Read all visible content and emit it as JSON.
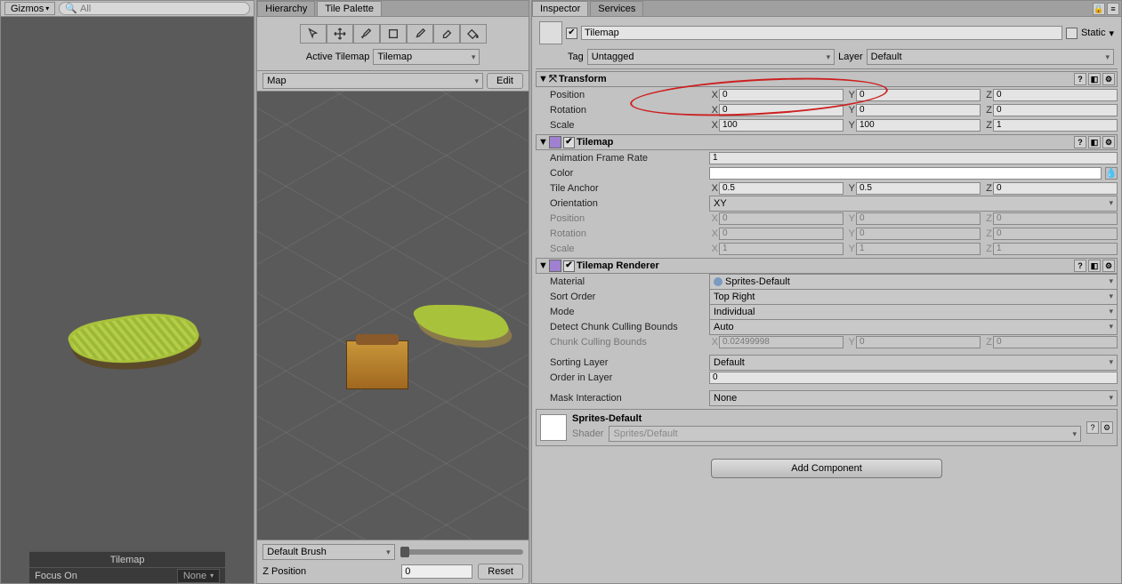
{
  "scene": {
    "gizmos_label": "Gizmos",
    "search_placeholder": "All",
    "footer_title": "Tilemap",
    "focus_on_label": "Focus On",
    "focus_on_value": "None"
  },
  "palette": {
    "tabs": {
      "hierarchy": "Hierarchy",
      "tile_palette": "Tile Palette"
    },
    "active_tilemap_label": "Active Tilemap",
    "active_tilemap_value": "Tilemap",
    "map_dd": "Map",
    "edit_btn": "Edit",
    "brush_dd": "Default Brush",
    "z_position_label": "Z Position",
    "z_position_value": "0",
    "reset_btn": "Reset"
  },
  "inspector": {
    "tabs": {
      "inspector": "Inspector",
      "services": "Services"
    },
    "go": {
      "enabled": true,
      "name": "Tilemap",
      "static_label": "Static"
    },
    "tag_label": "Tag",
    "tag_value": "Untagged",
    "layer_label": "Layer",
    "layer_value": "Default",
    "transform": {
      "title": "Transform",
      "position_label": "Position",
      "position": {
        "x": "0",
        "y": "0",
        "z": "0"
      },
      "rotation_label": "Rotation",
      "rotation": {
        "x": "0",
        "y": "0",
        "z": "0"
      },
      "scale_label": "Scale",
      "scale": {
        "x": "100",
        "y": "100",
        "z": "1"
      }
    },
    "tilemap": {
      "title": "Tilemap",
      "anim_label": "Animation Frame Rate",
      "anim_value": "1",
      "color_label": "Color",
      "anchor_label": "Tile Anchor",
      "anchor": {
        "x": "0.5",
        "y": "0.5",
        "z": "0"
      },
      "orient_label": "Orientation",
      "orient_value": "XY",
      "position_label": "Position",
      "position": {
        "x": "0",
        "y": "0",
        "z": "0"
      },
      "rotation_label": "Rotation",
      "rotation": {
        "x": "0",
        "y": "0",
        "z": "0"
      },
      "scale_label": "Scale",
      "scale": {
        "x": "1",
        "y": "1",
        "z": "1"
      }
    },
    "renderer": {
      "title": "Tilemap Renderer",
      "material_label": "Material",
      "material_value": "Sprites-Default",
      "sort_label": "Sort Order",
      "sort_value": "Top Right",
      "mode_label": "Mode",
      "mode_value": "Individual",
      "dccb_label": "Detect Chunk Culling Bounds",
      "dccb_value": "Auto",
      "ccb_label": "Chunk Culling Bounds",
      "ccb": {
        "x": "0.02499998",
        "y": "0",
        "z": "0"
      },
      "slayer_label": "Sorting Layer",
      "slayer_value": "Default",
      "order_label": "Order in Layer",
      "order_value": "0",
      "mask_label": "Mask Interaction",
      "mask_value": "None"
    },
    "material": {
      "name": "Sprites-Default",
      "shader_label": "Shader",
      "shader_value": "Sprites/Default"
    },
    "add_component": "Add Component"
  }
}
